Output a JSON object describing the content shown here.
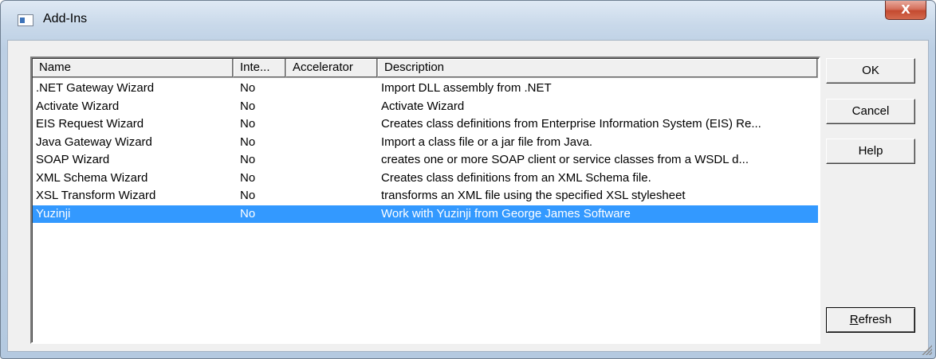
{
  "window": {
    "title": "Add-Ins",
    "close_glyph": "X",
    "accent_color": "#3399ff"
  },
  "list": {
    "columns": [
      "Name",
      "Inte...",
      "Accelerator",
      "Description"
    ],
    "rows": [
      {
        "name": ".NET Gateway Wizard",
        "inte": "No",
        "accelerator": "",
        "description": "Import DLL assembly from .NET"
      },
      {
        "name": "Activate Wizard",
        "inte": "No",
        "accelerator": "",
        "description": "Activate Wizard"
      },
      {
        "name": "EIS Request Wizard",
        "inte": "No",
        "accelerator": "",
        "description": "Creates class definitions from Enterprise Information System (EIS) Re..."
      },
      {
        "name": "Java Gateway Wizard",
        "inte": "No",
        "accelerator": "",
        "description": "Import a class file or a jar file from Java."
      },
      {
        "name": "SOAP Wizard",
        "inte": "No",
        "accelerator": "",
        "description": "creates one or more SOAP client or service classes from a WSDL d..."
      },
      {
        "name": "XML Schema Wizard",
        "inte": "No",
        "accelerator": "",
        "description": "Creates class definitions from an XML Schema file."
      },
      {
        "name": "XSL Transform Wizard",
        "inte": "No",
        "accelerator": "",
        "description": "transforms an XML file using the specified XSL stylesheet"
      },
      {
        "name": "Yuzinji",
        "inte": "No",
        "accelerator": "",
        "description": "Work with Yuzinji from George James Software"
      }
    ],
    "selected_index": 7
  },
  "buttons": {
    "ok": "OK",
    "cancel": "Cancel",
    "help": "Help",
    "refresh_mnemonic": "R",
    "refresh_rest": "efresh"
  }
}
